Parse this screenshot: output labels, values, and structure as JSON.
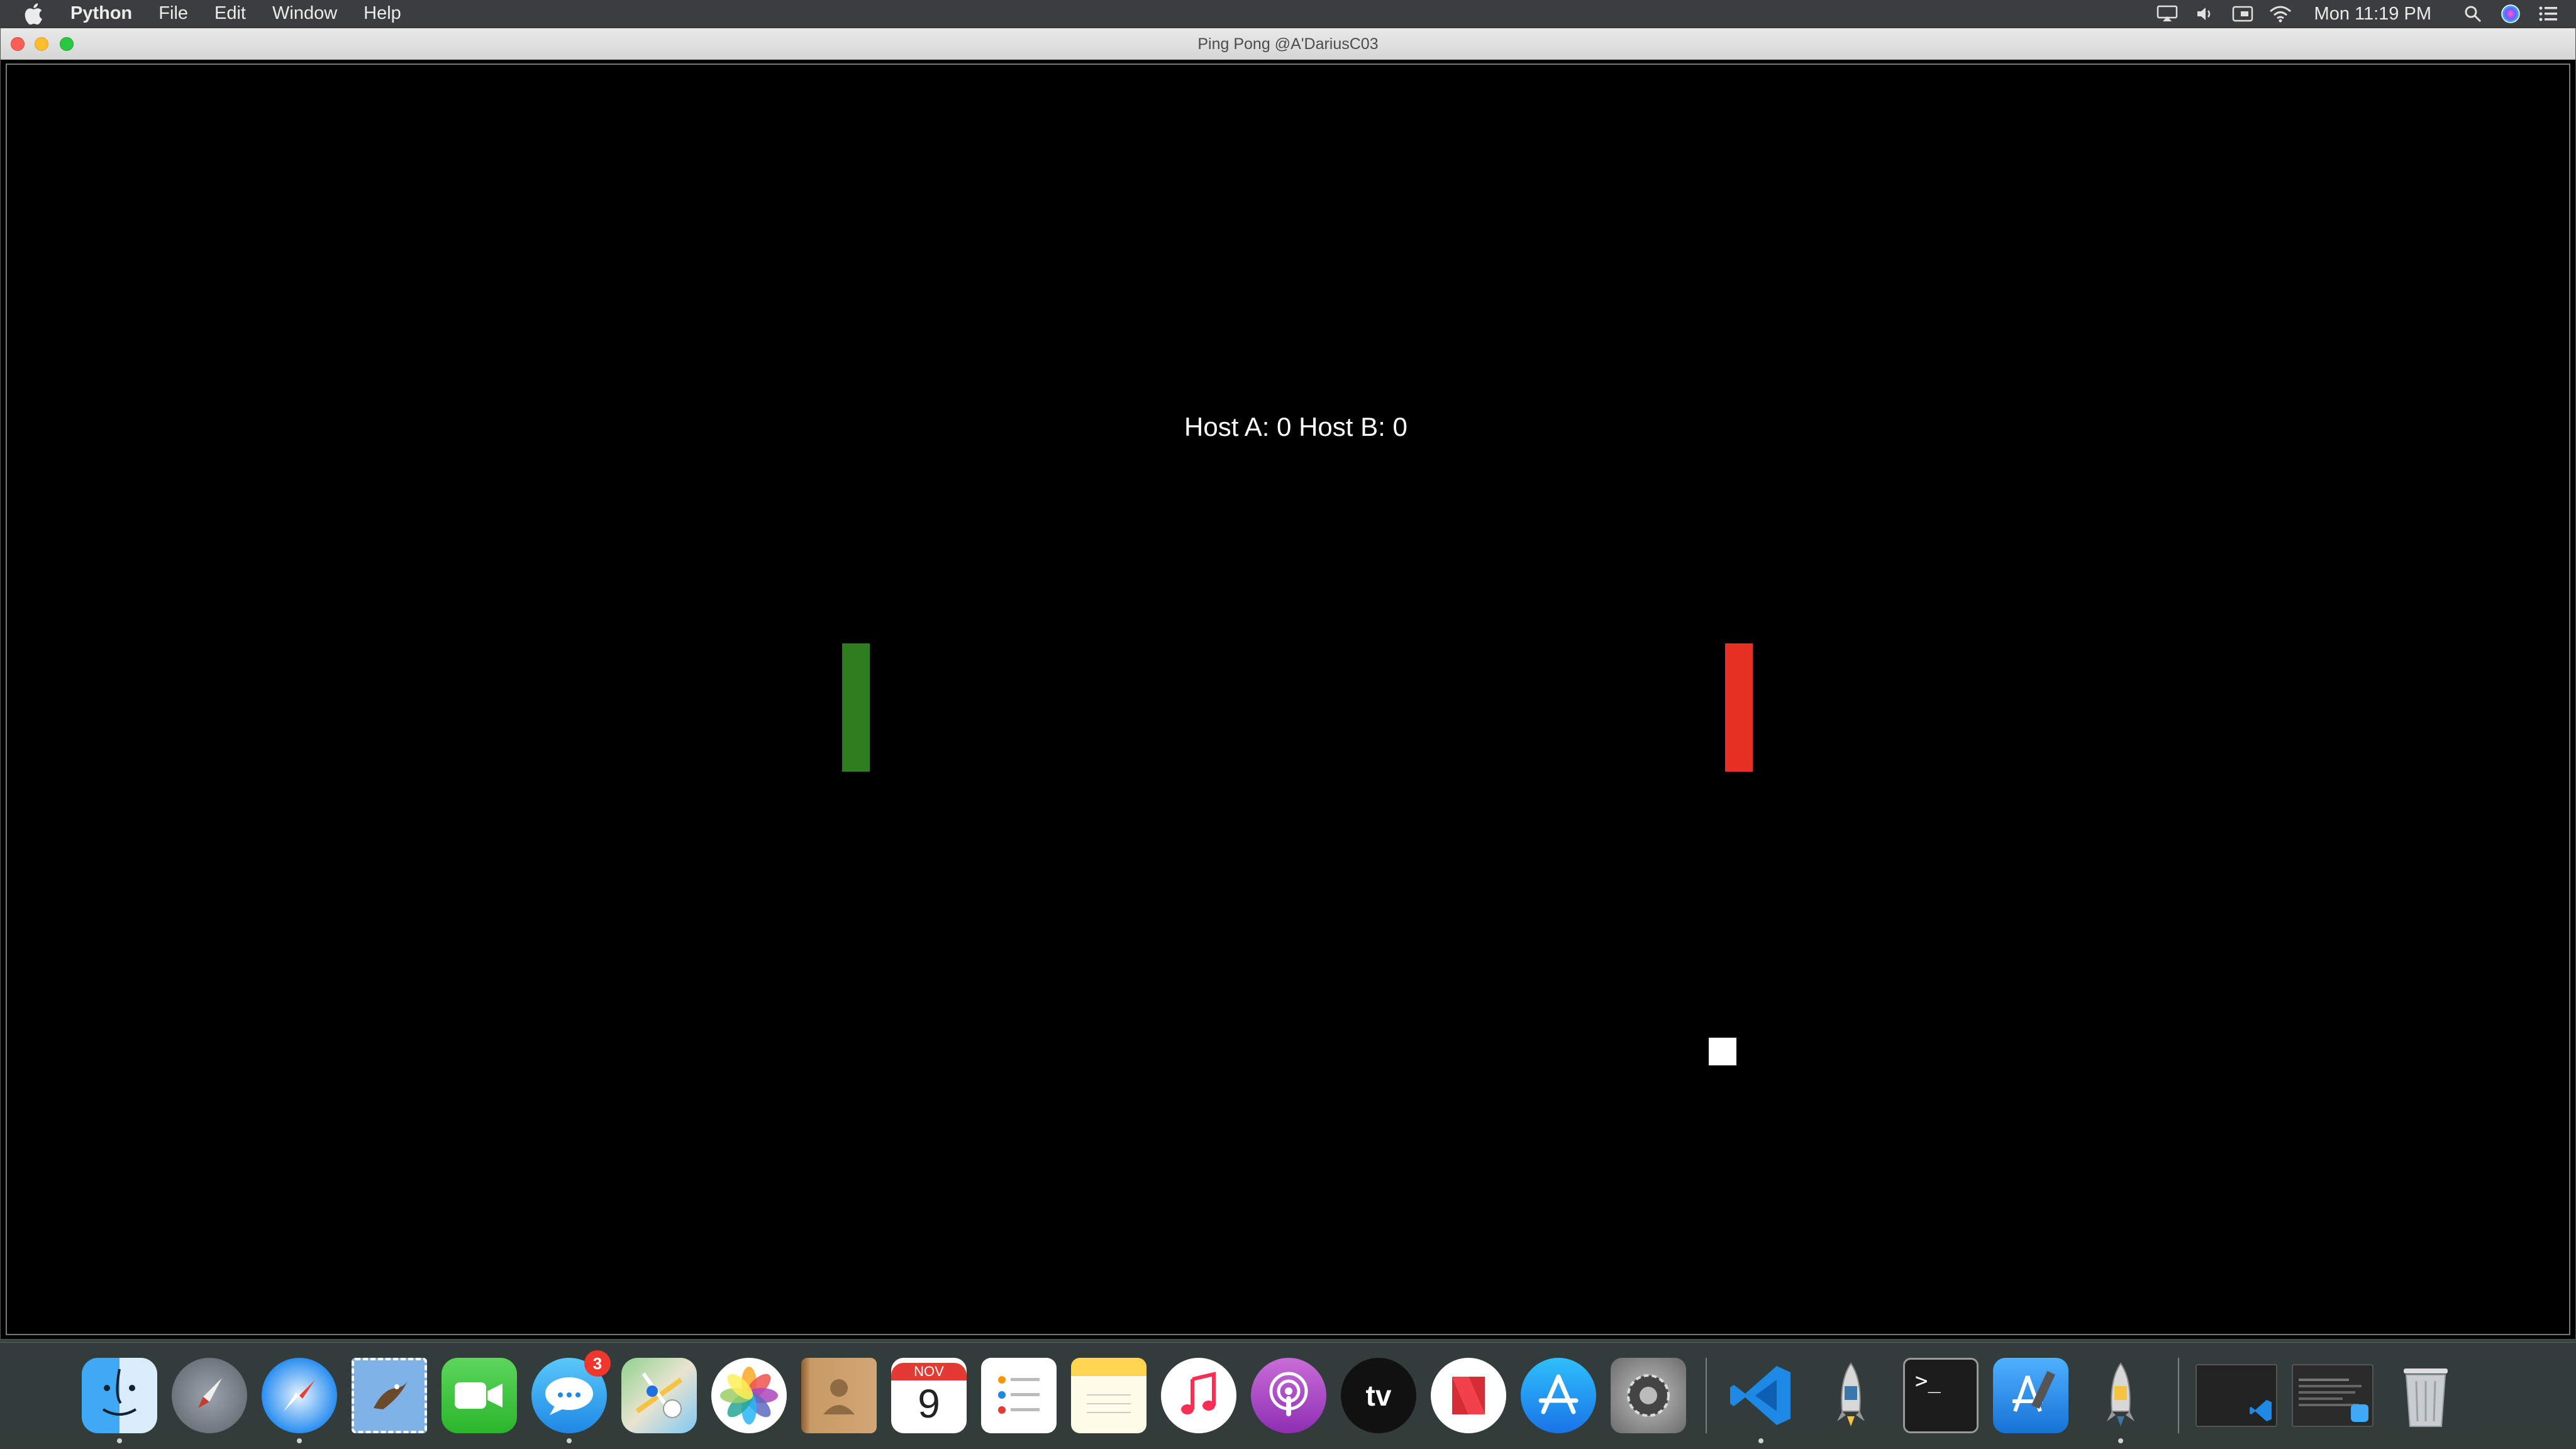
{
  "menubar": {
    "app_name": "Python",
    "menus": [
      "File",
      "Edit",
      "Window",
      "Help"
    ],
    "clock": "Mon 11:19 PM",
    "status_icons": [
      "airplay-icon",
      "volume-icon",
      "display-icon",
      "wifi-icon",
      "search-icon",
      "siri-icon",
      "control-center-icon"
    ]
  },
  "window": {
    "title": "Ping Pong @A'DariusC03"
  },
  "game": {
    "score_text": "Host A: 0   Host B: 0",
    "player_a_label": "Host A",
    "player_a_score": 0,
    "player_b_label": "Host B",
    "player_b_score": 0,
    "paddle_a_color": "#2e7d1f",
    "paddle_b_color": "#e63024",
    "ball_color": "#ffffff",
    "background_color": "#000000"
  },
  "dock": {
    "apps": [
      {
        "name": "finder",
        "running": true
      },
      {
        "name": "launchpad",
        "running": false
      },
      {
        "name": "safari",
        "running": true
      },
      {
        "name": "mail",
        "running": false
      },
      {
        "name": "facetime",
        "running": false
      },
      {
        "name": "messages",
        "running": true,
        "badge": "3"
      },
      {
        "name": "maps",
        "running": false
      },
      {
        "name": "photos",
        "running": false
      },
      {
        "name": "contacts",
        "running": false
      },
      {
        "name": "calendar",
        "running": false,
        "month": "NOV",
        "day": "9"
      },
      {
        "name": "reminders",
        "running": false
      },
      {
        "name": "notes",
        "running": false
      },
      {
        "name": "music",
        "running": false
      },
      {
        "name": "podcasts",
        "running": false
      },
      {
        "name": "tv",
        "running": false,
        "label": "tv"
      },
      {
        "name": "news",
        "running": false
      },
      {
        "name": "app-store",
        "running": false
      },
      {
        "name": "system-preferences",
        "running": false
      },
      {
        "name": "vscode",
        "running": true
      },
      {
        "name": "python-launcher",
        "running": false
      },
      {
        "name": "terminal",
        "running": false,
        "prompt": ">_"
      },
      {
        "name": "xcode",
        "running": false
      },
      {
        "name": "python",
        "running": true
      }
    ]
  }
}
